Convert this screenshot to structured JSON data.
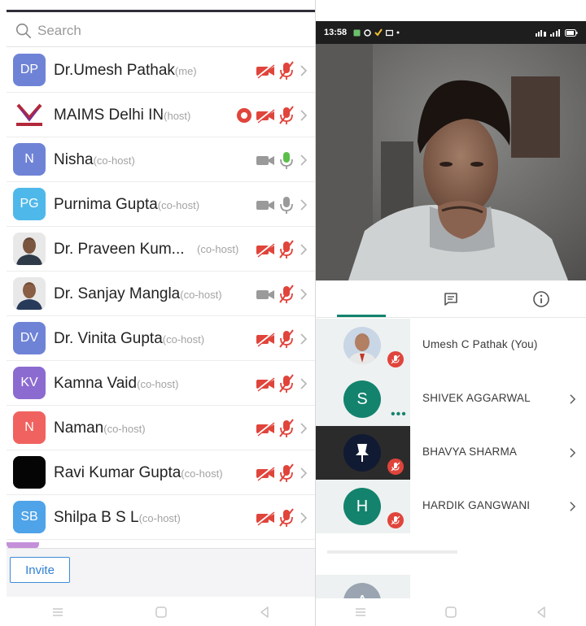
{
  "left_panel": {
    "search": {
      "placeholder": "Search"
    },
    "participants": [
      {
        "initials": "DP",
        "avatar_color": "#6f83d6",
        "name": "Dr.Umesh Pathak",
        "role": "(me)",
        "video": "off",
        "audio": "off",
        "recording": false
      },
      {
        "initials": "",
        "avatar_type": "logo",
        "name": "MAIMS Delhi IN",
        "role": "(host)",
        "video": "off",
        "audio": "off",
        "recording": true
      },
      {
        "initials": "N",
        "avatar_color": "#6f83d6",
        "name": "Nisha",
        "role": "(co-host)",
        "video": "on",
        "audio": "speaking",
        "recording": false
      },
      {
        "initials": "PG",
        "avatar_color": "#4fb8ea",
        "name": "Purnima Gupta",
        "role": "(co-host)",
        "video": "on",
        "audio": "on",
        "recording": false
      },
      {
        "initials": "",
        "avatar_type": "photo",
        "name": "Dr. Praveen Kum...",
        "role": "(co-host)",
        "video": "off",
        "audio": "off",
        "recording": false
      },
      {
        "initials": "",
        "avatar_type": "photo",
        "name": "Dr. Sanjay Mangla",
        "role": "(co-host)",
        "video": "on",
        "audio": "off",
        "recording": false
      },
      {
        "initials": "DV",
        "avatar_color": "#6f83d6",
        "name": "Dr. Vinita Gupta",
        "role": "(co-host)",
        "video": "off",
        "audio": "off",
        "recording": false
      },
      {
        "initials": "KV",
        "avatar_color": "#8c6bd0",
        "name": "Kamna Vaid",
        "role": "(co-host)",
        "video": "off",
        "audio": "off",
        "recording": false
      },
      {
        "initials": "N",
        "avatar_color": "#f0625f",
        "name": "Naman",
        "role": "(co-host)",
        "video": "off",
        "audio": "off",
        "recording": false
      },
      {
        "initials": "",
        "avatar_color": "#050505",
        "name": "Ravi Kumar Gupta",
        "role": "(co-host)",
        "video": "off",
        "audio": "off",
        "recording": false
      },
      {
        "initials": "SB",
        "avatar_color": "#4fa3e8",
        "name": "Shilpa B S L",
        "role": "(co-host)",
        "video": "off",
        "audio": "off",
        "recording": false
      }
    ],
    "invite_label": "Invite"
  },
  "right_panel": {
    "status_bar": {
      "time": "13:58"
    },
    "tabs": [
      "people",
      "chat",
      "info"
    ],
    "participants": [
      {
        "name": "Umesh C Pathak (You)",
        "avatar_type": "photo",
        "muted": true,
        "chevron": false
      },
      {
        "name": "SHIVEK AGGARWAL",
        "initials": "S",
        "avatar_color": "#13836d",
        "muted": false,
        "speaking": true,
        "chevron": true
      },
      {
        "name": "BHAVYA SHARMA",
        "avatar_type": "pinned",
        "muted": true,
        "chevron": true
      },
      {
        "name": "HARDIK GANGWANI",
        "initials": "H",
        "avatar_color": "#13836d",
        "muted": true,
        "chevron": true
      }
    ],
    "cut_off_participant": {
      "initials": "A"
    }
  },
  "colors": {
    "muted_red": "#e0443b",
    "zoom_blue": "#2f7fd4",
    "meet_green": "#13836d",
    "speaking_green": "#5cbf4a"
  }
}
